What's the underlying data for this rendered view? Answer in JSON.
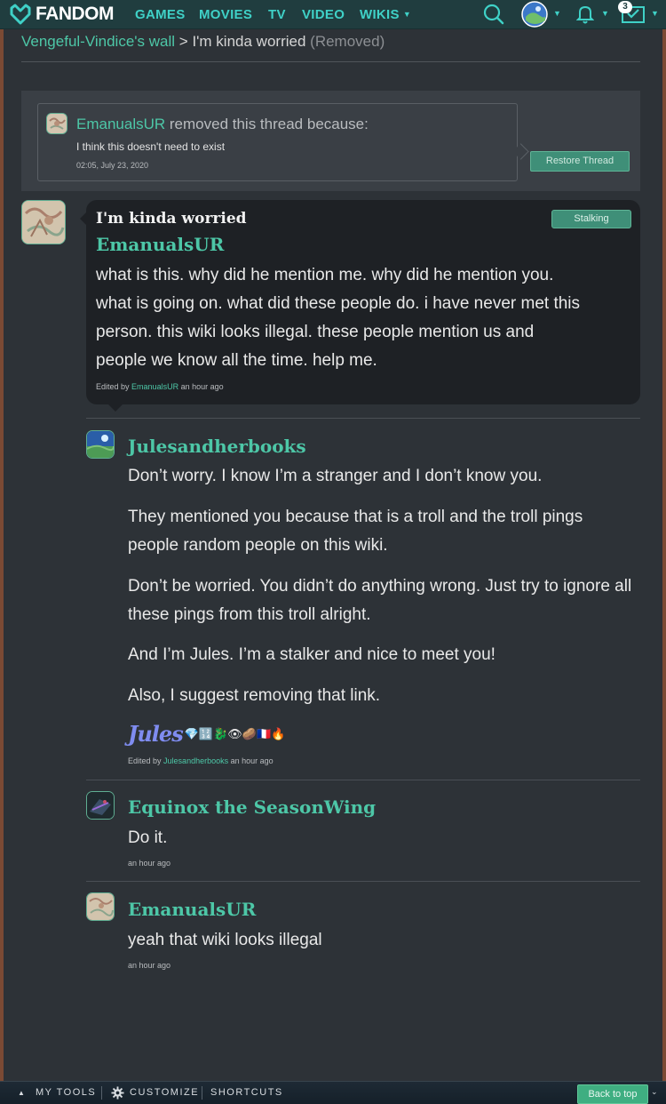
{
  "nav": {
    "brand": "FANDOM",
    "links": [
      "GAMES",
      "MOVIES",
      "TV",
      "VIDEO",
      "WIKIS"
    ],
    "notification_count": "3"
  },
  "breadcrumb": {
    "wall_link": "Vengeful-Vindice's wall",
    "separator": ">",
    "thread": "I'm kinda worried",
    "status": "(Removed)"
  },
  "removed_notice": {
    "user": "EmanualsUR",
    "text": "removed this thread because:",
    "reason": "I think this doesn't need to exist",
    "date": "02:05, July 23, 2020",
    "restore_label": "Restore Thread"
  },
  "thread": {
    "title": "I'm kinda worried",
    "stalking_label": "Stalking",
    "author": "EmanualsUR",
    "body_lines": [
      "what is this. why did he mention me. why did he mention you.",
      "what is going on. what did these people do. i have never met this",
      "person. this wiki looks illegal. these people mention us and",
      "people we know all the time. help me."
    ],
    "edited_prefix": "Edited by",
    "edited_user": "EmanualsUR",
    "edited_time": "an hour ago"
  },
  "replies": [
    {
      "author": "Julesandherbooks",
      "paragraphs": [
        "Don’t worry. I know I’m a stranger and I don’t know you.",
        "They mentioned you because that is a troll and the troll pings people random people on this wiki.",
        "Don’t be worried. You didn’t do anything wrong. Just try to ignore all these pings from this troll alright.",
        "And I’m Jules. I’m a stalker and nice to meet you!",
        "Also, I suggest removing that link."
      ],
      "signature": "Jules",
      "signature_emoji": "💎🔢🐉👁🥔🇫🇷🔥",
      "edited_prefix": "Edited by",
      "edited_user": "Julesandherbooks",
      "edited_time": "an hour ago"
    },
    {
      "author": "Equinox the SeasonWing",
      "paragraphs": [
        "Do it."
      ],
      "time": "an hour ago"
    },
    {
      "author": "EmanualsUR",
      "paragraphs": [
        "yeah that wiki looks illegal"
      ],
      "time": "an hour ago"
    }
  ],
  "toolbar": {
    "my_tools": "MY TOOLS",
    "customize": "CUSTOMIZE",
    "shortcuts": "SHORTCUTS",
    "back_to_top": "Back to top"
  }
}
